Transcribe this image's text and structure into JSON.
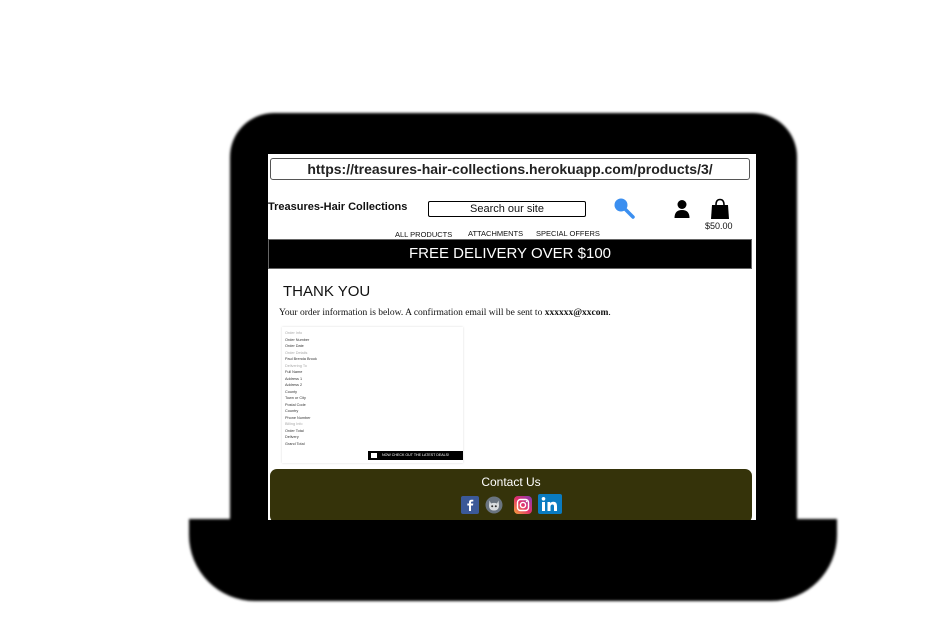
{
  "browser": {
    "url": "https://treasures-hair-collections.herokuapp.com/products/3/"
  },
  "header": {
    "brand": "Treasures-Hair Collections",
    "search_placeholder": "Search our site",
    "bag_total": "$50.00"
  },
  "nav": {
    "items": [
      "ALL PRODUCTS",
      "ATTACHMENTS",
      "SPECIAL OFFERS"
    ]
  },
  "banner": {
    "text": "FREE DELIVERY OVER $100"
  },
  "main": {
    "title": "THANK YOU",
    "confirmation_text": "Your order information is below. A confirmation email will be sent to ",
    "confirmation_email": "xxxxxx@xxcom",
    "confirmation_end": "."
  },
  "order": {
    "rows": [
      "Order Info",
      "Order Number",
      "Order Date",
      "Order Details",
      "Paul Brenda Brook",
      "Delivering To",
      "Full Name",
      "Address 1",
      "Address 2",
      "County",
      "Town or City",
      "Postal Code",
      "Country",
      "Phone Number",
      "Billing Info",
      "Order Total",
      "Delivery",
      "Grand Total"
    ],
    "button_label": "NOW CHECK OUT THE LATEST DEALS!"
  },
  "footer": {
    "title": "Contact Us",
    "social_icons": [
      "facebook-icon",
      "github-icon",
      "instagram-icon",
      "linkedin-icon"
    ]
  },
  "colors": {
    "footer_bg": "#35330a",
    "banner_bg": "#000000",
    "search_icon": "#3b8ff0"
  }
}
